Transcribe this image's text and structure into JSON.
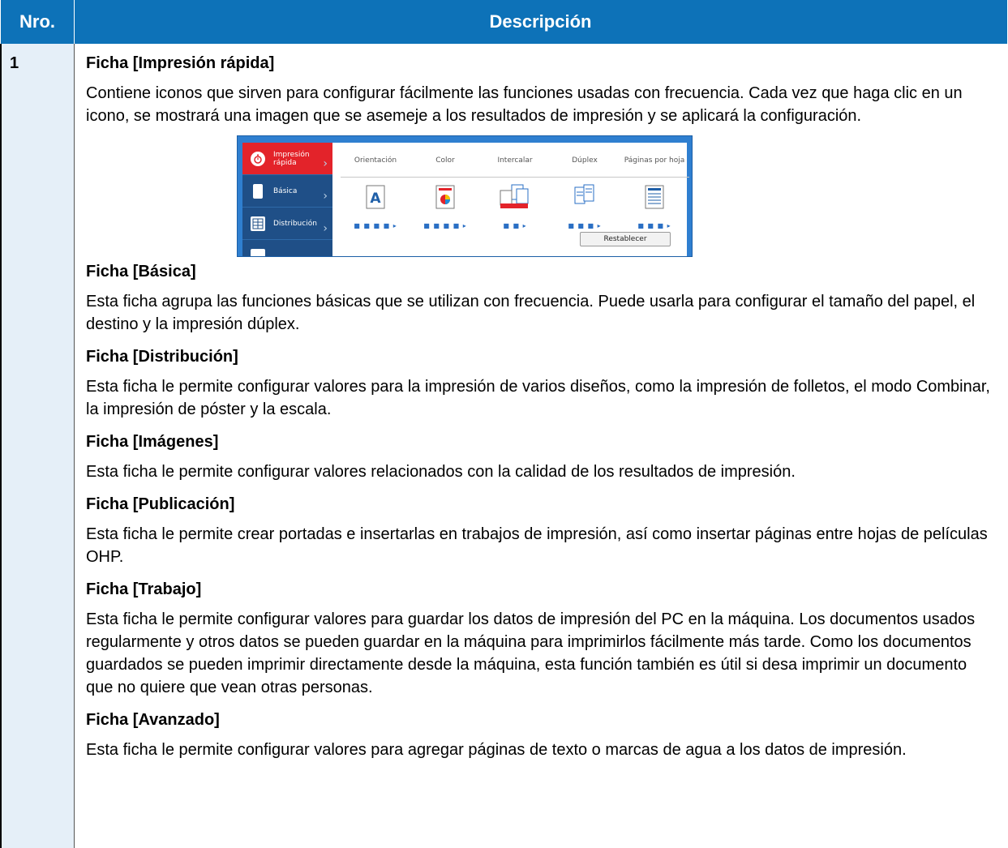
{
  "header": {
    "col_num": "Nro.",
    "col_desc": "Descripción"
  },
  "row": {
    "num": "1",
    "sections": [
      {
        "title": "Ficha [Impresión rápida]",
        "body": "Contiene iconos que sirven para configurar fácilmente las funciones usadas con frecuencia. Cada vez que haga clic en un icono, se mostrará una imagen que se asemeje a los resultados de impresión y se aplicará la configuración."
      },
      {
        "title": "Ficha [Básica]",
        "body": "Esta ficha agrupa las funciones básicas que se utilizan con frecuencia. Puede usarla para configurar el tamaño del papel, el destino y la impresión dúplex."
      },
      {
        "title": "Ficha [Distribución]",
        "body": "Esta ficha le permite configurar valores para la impresión de varios diseños, como la impresión de folletos, el modo Combinar, la impresión de póster y la escala."
      },
      {
        "title": "Ficha [Imágenes]",
        "body": "Esta ficha le permite configurar valores relacionados con la calidad de los resultados de impresión."
      },
      {
        "title": "Ficha [Publicación]",
        "body": "Esta ficha le permite crear portadas e insertarlas en trabajos de impresión, así como insertar páginas entre hojas de películas OHP."
      },
      {
        "title": "Ficha [Trabajo]",
        "body": "Esta ficha le permite configurar valores para guardar los datos de impresión del PC en la máquina. Los documentos usados regularmente y otros datos se pueden guardar en la máquina para imprimirlos fácilmente más tarde. Como los documentos guardados se pueden imprimir directamente desde la máquina, esta función también es útil si desa imprimir un documento que no quiere que vean otras personas."
      },
      {
        "title": "Ficha [Avanzado]",
        "body": "Esta ficha le permite configurar valores para agregar páginas de texto o marcas de agua a los datos de impresión."
      }
    ]
  },
  "screenshot": {
    "tabs": [
      "Impresión rápida",
      "Básica",
      "Distribución"
    ],
    "options": [
      "Orientación",
      "Color",
      "Intercalar",
      "Dúplex",
      "Páginas por hoja"
    ],
    "reset_label": "Restablecer",
    "accent_color": "#e3232a",
    "sidebar_color": "#1f4f87",
    "header_color": "#0d72b8"
  }
}
